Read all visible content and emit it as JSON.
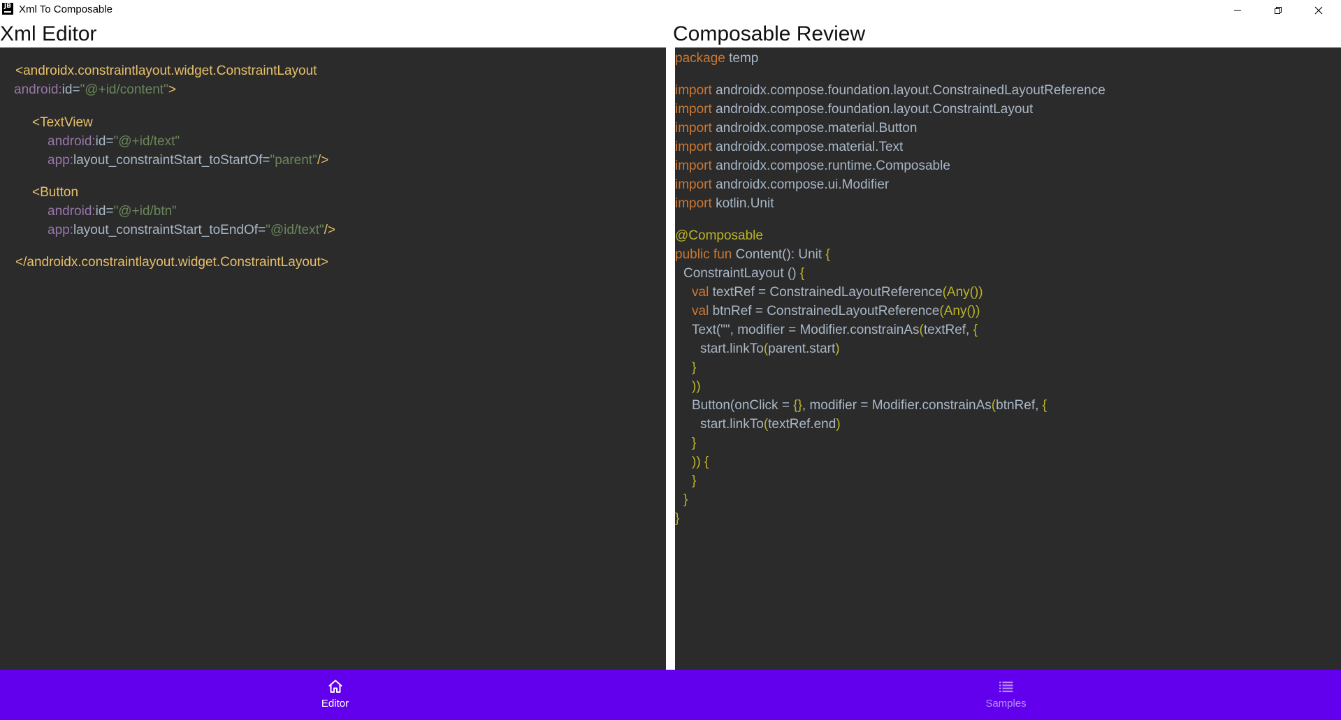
{
  "window": {
    "icon_text": "JB",
    "title": "Xml To Composable",
    "controls": [
      "minimize",
      "maximize",
      "close"
    ]
  },
  "xml_editor": {
    "title": "Xml Editor",
    "lines": [
      [
        {
          "t": "<androidx.constraintlayout.widget.ConstraintLayout",
          "c": "tag"
        }
      ],
      [
        {
          "t": "android:",
          "c": "ns"
        },
        {
          "t": "id=",
          "c": "txt"
        },
        {
          "t": "\"@+id/content\"",
          "c": "str"
        },
        {
          "t": ">",
          "c": "tag"
        }
      ],
      [
        {
          "t": "<TextView",
          "c": "tag"
        }
      ],
      [
        {
          "t": "android:",
          "c": "ns"
        },
        {
          "t": "id=",
          "c": "txt"
        },
        {
          "t": "\"@+id/text\"",
          "c": "str"
        }
      ],
      [
        {
          "t": "app:",
          "c": "ns"
        },
        {
          "t": "layout_constraintStart_toStartOf=",
          "c": "txt"
        },
        {
          "t": "\"parent\"",
          "c": "str"
        },
        {
          "t": "/>",
          "c": "tag"
        }
      ],
      [
        {
          "t": "<Button",
          "c": "tag"
        }
      ],
      [
        {
          "t": "android:",
          "c": "ns"
        },
        {
          "t": "id=",
          "c": "txt"
        },
        {
          "t": "\"@+id/btn\"",
          "c": "str"
        }
      ],
      [
        {
          "t": "app:",
          "c": "ns"
        },
        {
          "t": "layout_constraintStart_toEndOf=",
          "c": "txt"
        },
        {
          "t": "\"@id/text\"",
          "c": "str"
        },
        {
          "t": "/>",
          "c": "tag"
        }
      ],
      [
        {
          "t": "</androidx.constraintlayout.widget.ConstraintLayout>",
          "c": "tag"
        }
      ]
    ]
  },
  "composable_review": {
    "title": "Composable Review",
    "lines": [
      [
        {
          "t": "package",
          "c": "kw"
        },
        {
          "t": " temp",
          "c": "txt"
        }
      ],
      [
        {
          "t": "import",
          "c": "kw"
        },
        {
          "t": " androidx.compose.foundation.layout.ConstrainedLayoutReference",
          "c": "txt"
        }
      ],
      [
        {
          "t": "import",
          "c": "kw"
        },
        {
          "t": " androidx.compose.foundation.layout.ConstraintLayout",
          "c": "txt"
        }
      ],
      [
        {
          "t": "import",
          "c": "kw"
        },
        {
          "t": " androidx.compose.material.Button",
          "c": "txt"
        }
      ],
      [
        {
          "t": "import",
          "c": "kw"
        },
        {
          "t": " androidx.compose.material.Text",
          "c": "txt"
        }
      ],
      [
        {
          "t": "import",
          "c": "kw"
        },
        {
          "t": " androidx.compose.runtime.Composable",
          "c": "txt"
        }
      ],
      [
        {
          "t": "import",
          "c": "kw"
        },
        {
          "t": " androidx.compose.ui.Modifier",
          "c": "txt"
        }
      ],
      [
        {
          "t": "import",
          "c": "kw"
        },
        {
          "t": " kotlin.Unit",
          "c": "txt"
        }
      ],
      [
        {
          "t": "@Composable",
          "c": "ann"
        }
      ],
      [
        {
          "t": "public fun",
          "c": "kw"
        },
        {
          "t": " Content(): Unit ",
          "c": "txt"
        },
        {
          "t": "{",
          "c": "ann"
        }
      ],
      [
        {
          "t": "ConstraintLayout () ",
          "c": "txt"
        },
        {
          "t": "{",
          "c": "ann"
        }
      ],
      [
        {
          "t": "val",
          "c": "kw"
        },
        {
          "t": " textRef = ConstrainedLayoutReference",
          "c": "txt"
        },
        {
          "t": "(Any())",
          "c": "ann"
        }
      ],
      [
        {
          "t": "val",
          "c": "kw"
        },
        {
          "t": " btnRef = ConstrainedLayoutReference",
          "c": "txt"
        },
        {
          "t": "(Any())",
          "c": "ann"
        }
      ],
      [
        {
          "t": "Text(\"\", modifier = Modifier.constrainAs",
          "c": "txt"
        },
        {
          "t": "(",
          "c": "ann"
        },
        {
          "t": "textRef, ",
          "c": "txt"
        },
        {
          "t": "{",
          "c": "ann"
        }
      ],
      [
        {
          "t": "start.linkTo",
          "c": "txt"
        },
        {
          "t": "(",
          "c": "ann"
        },
        {
          "t": "parent.start",
          "c": "txt"
        },
        {
          "t": ")",
          "c": "ann"
        }
      ],
      [
        {
          "t": "}",
          "c": "ann"
        }
      ],
      [
        {
          "t": "))",
          "c": "ann"
        }
      ],
      [
        {
          "t": "Button(onClick = ",
          "c": "txt"
        },
        {
          "t": "{}",
          "c": "ann"
        },
        {
          "t": ", modifier = Modifier.constrainAs",
          "c": "txt"
        },
        {
          "t": "(",
          "c": "ann"
        },
        {
          "t": "btnRef, ",
          "c": "txt"
        },
        {
          "t": "{",
          "c": "ann"
        }
      ],
      [
        {
          "t": "start.linkTo",
          "c": "txt"
        },
        {
          "t": "(",
          "c": "ann"
        },
        {
          "t": "textRef.end",
          "c": "txt"
        },
        {
          "t": ")",
          "c": "ann"
        }
      ],
      [
        {
          "t": "}",
          "c": "ann"
        }
      ],
      [
        {
          "t": ")) {",
          "c": "ann"
        }
      ],
      [
        {
          "t": "}",
          "c": "ann"
        }
      ],
      [
        {
          "t": "}",
          "c": "ann"
        }
      ],
      [
        {
          "t": "}",
          "c": "ann"
        }
      ]
    ]
  },
  "bottom_nav": {
    "items": [
      {
        "label": "Editor",
        "icon": "home-icon",
        "active": true
      },
      {
        "label": "Samples",
        "icon": "list-icon",
        "active": false
      }
    ]
  },
  "colors": {
    "editor_background": "#2b2b2b",
    "nav_background": "#6200ee",
    "tag": "#e8bf6a",
    "namespace": "#9876aa",
    "string": "#6a8759",
    "keyword": "#cc7832",
    "annotation": "#bbb529",
    "text": "#a9b7c6"
  }
}
